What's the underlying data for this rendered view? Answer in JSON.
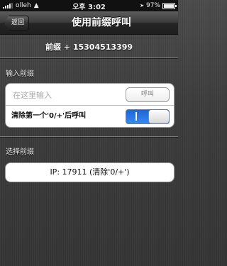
{
  "status_bar": {
    "carrier": "olleh",
    "time": "오후 3:02",
    "battery": "97%",
    "battery_level": 0.97
  },
  "nav": {
    "back_label": "返回",
    "title": "使用前缀呼叫"
  },
  "prefix_info": "前缀 + 15304513399",
  "input_section": {
    "label": "输入前缀",
    "placeholder": "在这里输入",
    "value": "",
    "call_label": "呼叫",
    "toggle_label": "清除第一个'0/+'后呼叫",
    "toggle_on": true
  },
  "select_section": {
    "label": "选择前缀",
    "item": "IP:  17911 (清除'0/+')"
  }
}
